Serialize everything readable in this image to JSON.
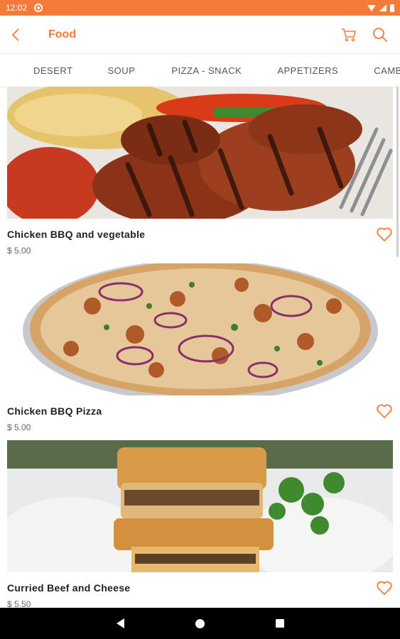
{
  "status": {
    "time": "12:02"
  },
  "header": {
    "title": "Food"
  },
  "icons": {
    "back": "back-chevron-icon",
    "cart": "cart-icon",
    "search": "search-icon",
    "favorite": "heart-outline-icon"
  },
  "colors": {
    "accent": "#f27b3a"
  },
  "tabs": [
    {
      "label": "DESERT"
    },
    {
      "label": "SOUP"
    },
    {
      "label": "PIZZA - SNACK"
    },
    {
      "label": "APPETIZERS"
    },
    {
      "label": "CAMBODIAN FOOD"
    }
  ],
  "items": [
    {
      "name": "Chicken BBQ and vegetable",
      "price": "$ 5.00"
    },
    {
      "name": "Chicken BBQ Pizza",
      "price": "$ 5.00"
    },
    {
      "name": "Curried Beef and Cheese",
      "price": "$ 5.50"
    }
  ]
}
